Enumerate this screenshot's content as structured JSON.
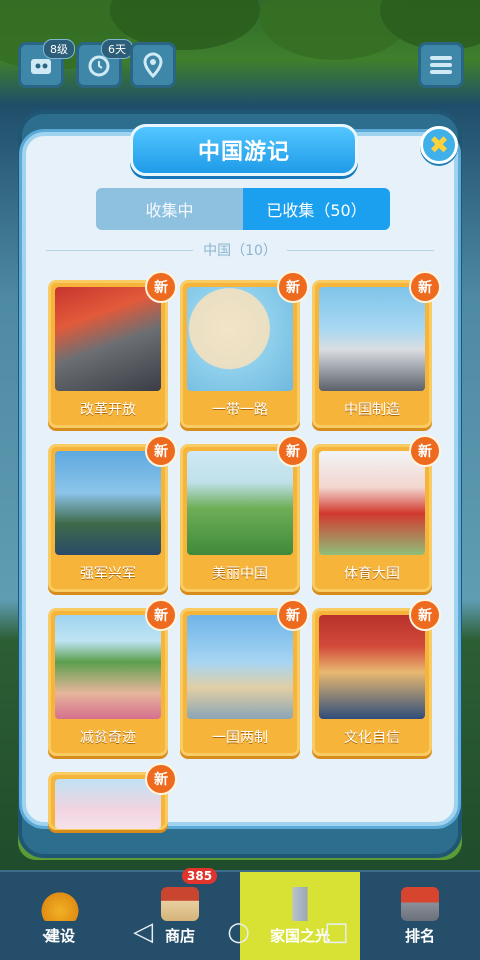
{
  "hud": {
    "level_tag": "8级",
    "days_tag": "6天"
  },
  "dialog": {
    "title": "中国游记",
    "tabs": [
      {
        "label": "收集中",
        "active": false
      },
      {
        "label": "已收集（50）",
        "active": true
      }
    ],
    "section_title": "中国（10）",
    "new_badge": "新",
    "cards": [
      {
        "label": "改革开放"
      },
      {
        "label": "一带一路"
      },
      {
        "label": "中国制造"
      },
      {
        "label": "强军兴军"
      },
      {
        "label": "美丽中国"
      },
      {
        "label": "体育大国"
      },
      {
        "label": "减贫奇迹"
      },
      {
        "label": "一国两制"
      },
      {
        "label": "文化自信"
      },
      {
        "label": ""
      }
    ]
  },
  "bottom_bar": {
    "tabs": [
      {
        "label": "建设"
      },
      {
        "label": "商店",
        "badge": "385"
      },
      {
        "label": "家国之光"
      },
      {
        "label": "排名"
      }
    ]
  },
  "colors": {
    "accent_blue": "#1aa0ef",
    "card_orange": "#f6b43a",
    "new_badge": "#ee6a1e",
    "active_tab": "#d7e234"
  }
}
